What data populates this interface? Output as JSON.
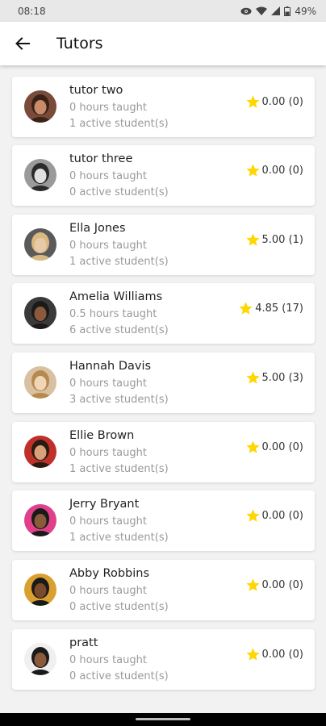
{
  "status": {
    "time": "08:18",
    "battery": "49%"
  },
  "appbar": {
    "title": "Tutors",
    "back_icon": "arrow-left-icon"
  },
  "colors": {
    "star": "#FFD600",
    "app_bar_bg": "#ffffff",
    "page_bg": "#f2f2f2"
  },
  "tutors": [
    {
      "name": "tutor two",
      "hours": "0 hours taught",
      "students": "1 active student(s)",
      "rating": "0.00 (0)",
      "avatar_bg": "#7a4a3a",
      "avatar_skin": "#c98b6a",
      "avatar_hair": "#3a2218"
    },
    {
      "name": "tutor three",
      "hours": "0 hours taught",
      "students": "0 active student(s)",
      "rating": "0.00 (0)",
      "avatar_bg": "#9a9a9a",
      "avatar_skin": "#e0e0e0",
      "avatar_hair": "#2a2a2a"
    },
    {
      "name": "Ella Jones",
      "hours": "0 hours taught",
      "students": "1 active student(s)",
      "rating": "5.00 (1)",
      "avatar_bg": "#5a5a5a",
      "avatar_skin": "#e8c9a8",
      "avatar_hair": "#d9b980"
    },
    {
      "name": "Amelia Williams",
      "hours": "0.5 hours taught",
      "students": "6 active student(s)",
      "rating": "4.85 (17)",
      "avatar_bg": "#3a3a3a",
      "avatar_skin": "#8a5a3a",
      "avatar_hair": "#1a1a1a"
    },
    {
      "name": "Hannah Davis",
      "hours": "0 hours taught",
      "students": "3 active student(s)",
      "rating": "5.00 (3)",
      "avatar_bg": "#d9c0a0",
      "avatar_skin": "#f0d5b8",
      "avatar_hair": "#b58a50"
    },
    {
      "name": "Ellie Brown",
      "hours": "0 hours taught",
      "students": "1 active student(s)",
      "rating": "0.00 (0)",
      "avatar_bg": "#c0302a",
      "avatar_skin": "#d9a07a",
      "avatar_hair": "#2a1a10"
    },
    {
      "name": "Jerry Bryant",
      "hours": "0 hours taught",
      "students": "1 active student(s)",
      "rating": "0.00 (0)",
      "avatar_bg": "#e0408a",
      "avatar_skin": "#8a5a3a",
      "avatar_hair": "#1a1a1a"
    },
    {
      "name": "Abby Robbins",
      "hours": "0 hours taught",
      "students": "0 active student(s)",
      "rating": "0.00 (0)",
      "avatar_bg": "#d9a030",
      "avatar_skin": "#7a4a2a",
      "avatar_hair": "#1a1a1a"
    },
    {
      "name": "pratt",
      "hours": "0 hours taught",
      "students": "0 active student(s)",
      "rating": "0.00 (0)",
      "avatar_bg": "#f0f0f0",
      "avatar_skin": "#8a5a3a",
      "avatar_hair": "#1a1a1a"
    }
  ]
}
